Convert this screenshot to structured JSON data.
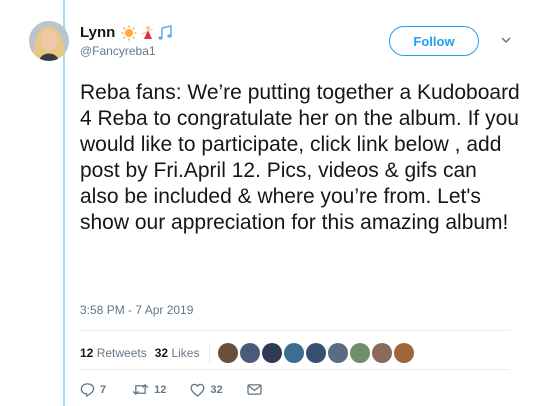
{
  "tweet": {
    "display_name": "Lynn",
    "handle": "@Fancyreba1",
    "follow_label": "Follow",
    "text": "Reba fans: We’re putting together a Kudoboard 4  Reba to congratulate her on the album. If you would like to participate, click link below , add post by Fri.April 12. Pics, videos & gifs can also be included & where you’re from. Let's show our appreciation for this amazing album!",
    "timestamp": "3:58 PM - 7 Apr 2019",
    "retweets_count": "12",
    "retweets_label": "Retweets",
    "likes_count": "32",
    "likes_label": "Likes"
  },
  "actions": {
    "reply_count": "7",
    "retweet_count": "12",
    "like_count": "32"
  },
  "colors": {
    "accent": "#1da1f2",
    "thread_line": "#a7d8f5",
    "muted_text": "#657786"
  },
  "icons": [
    "sun-emoji-icon",
    "dancer-emoji-icon",
    "music-notes-emoji-icon",
    "chevron-down-icon",
    "reply-icon",
    "retweet-icon",
    "heart-icon",
    "message-icon"
  ]
}
